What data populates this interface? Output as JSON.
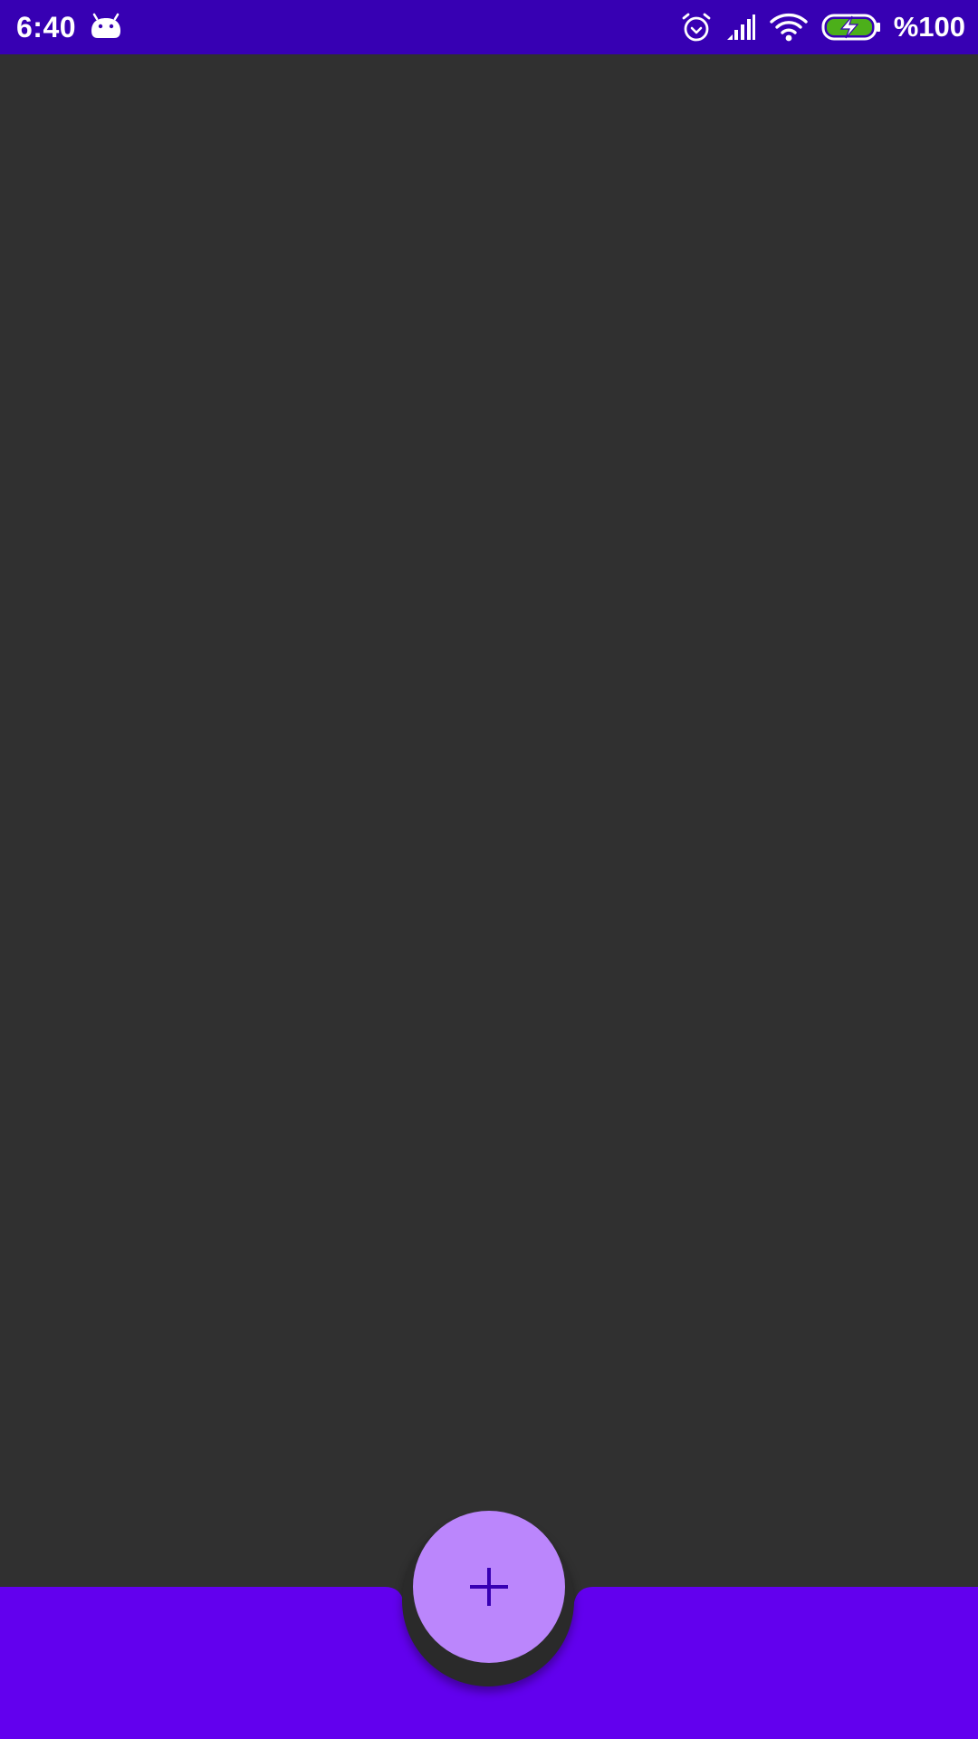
{
  "status_bar": {
    "time": "6:40",
    "battery_text": "%100",
    "app_icon": "android-icon",
    "icons": [
      "alarm-icon",
      "signal-icon",
      "wifi-icon",
      "battery-charging-icon"
    ],
    "background_color": "#3700b3"
  },
  "content": {
    "background_color": "#303030"
  },
  "bottom_app_bar": {
    "background_color": "#6200ee"
  },
  "fab": {
    "icon": "add-icon",
    "background_color": "#bb86fc",
    "icon_color": "#3700b3"
  }
}
